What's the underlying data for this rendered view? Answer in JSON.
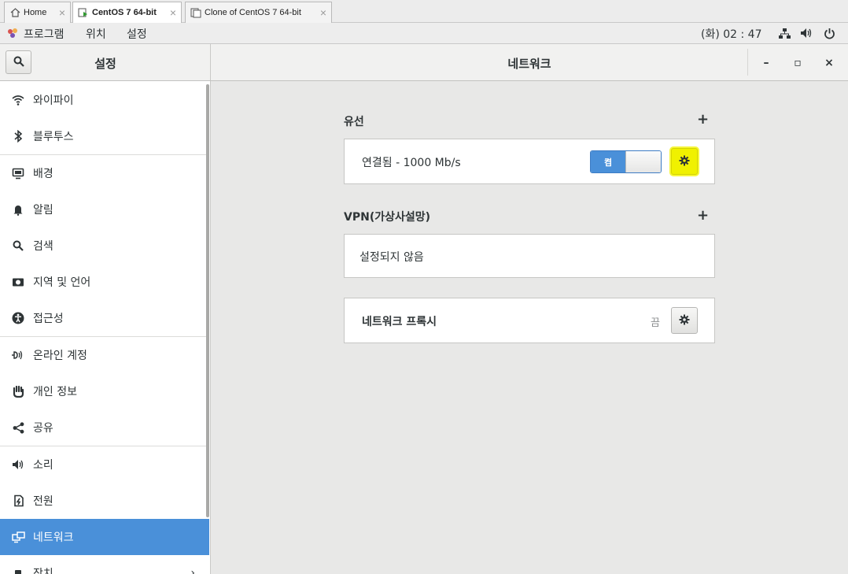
{
  "vm_tabs": [
    {
      "label": "Home"
    },
    {
      "label": "CentOS 7 64-bit"
    },
    {
      "label": "Clone of CentOS 7 64-bit"
    }
  ],
  "top_panel": {
    "apps_label": "프로그램",
    "places_label": "위치",
    "settings_label": "설정",
    "clock": "(화) 02 : 47"
  },
  "header": {
    "left_title": "설정",
    "main_title": "네트워크",
    "minimize": "–",
    "maximize": "▫",
    "close": "×"
  },
  "sidebar": {
    "items": [
      {
        "label": "와이파이",
        "icon": "wifi-icon"
      },
      {
        "label": "블루투스",
        "icon": "bluetooth-icon"
      },
      {
        "label": "배경",
        "icon": "background-icon"
      },
      {
        "label": "알림",
        "icon": "bell-icon"
      },
      {
        "label": "검색",
        "icon": "search-icon"
      },
      {
        "label": "지역 및 언어",
        "icon": "region-icon"
      },
      {
        "label": "접근성",
        "icon": "accessibility-icon"
      },
      {
        "label": "온라인 계정",
        "icon": "online-accounts-icon"
      },
      {
        "label": "개인 정보",
        "icon": "privacy-hand-icon"
      },
      {
        "label": "공유",
        "icon": "share-icon"
      },
      {
        "label": "소리",
        "icon": "sound-icon"
      },
      {
        "label": "전원",
        "icon": "power-icon"
      },
      {
        "label": "네트워크",
        "icon": "network-icon"
      },
      {
        "label": "장치",
        "icon": "devices-icon"
      }
    ],
    "selected_index": 12
  },
  "main": {
    "wired": {
      "title": "유선",
      "add": "+",
      "status": "연결됨 - 1000 Mb/s",
      "toggle_label": "켬",
      "toggle_state": "on"
    },
    "vpn": {
      "title": "VPN(가상사설망)",
      "add": "+",
      "empty_text": "설정되지 않음"
    },
    "proxy": {
      "title": "네트워크 프록시",
      "state": "끔"
    }
  },
  "colors": {
    "accent": "#4a90d9",
    "highlight": "#f0f100"
  }
}
